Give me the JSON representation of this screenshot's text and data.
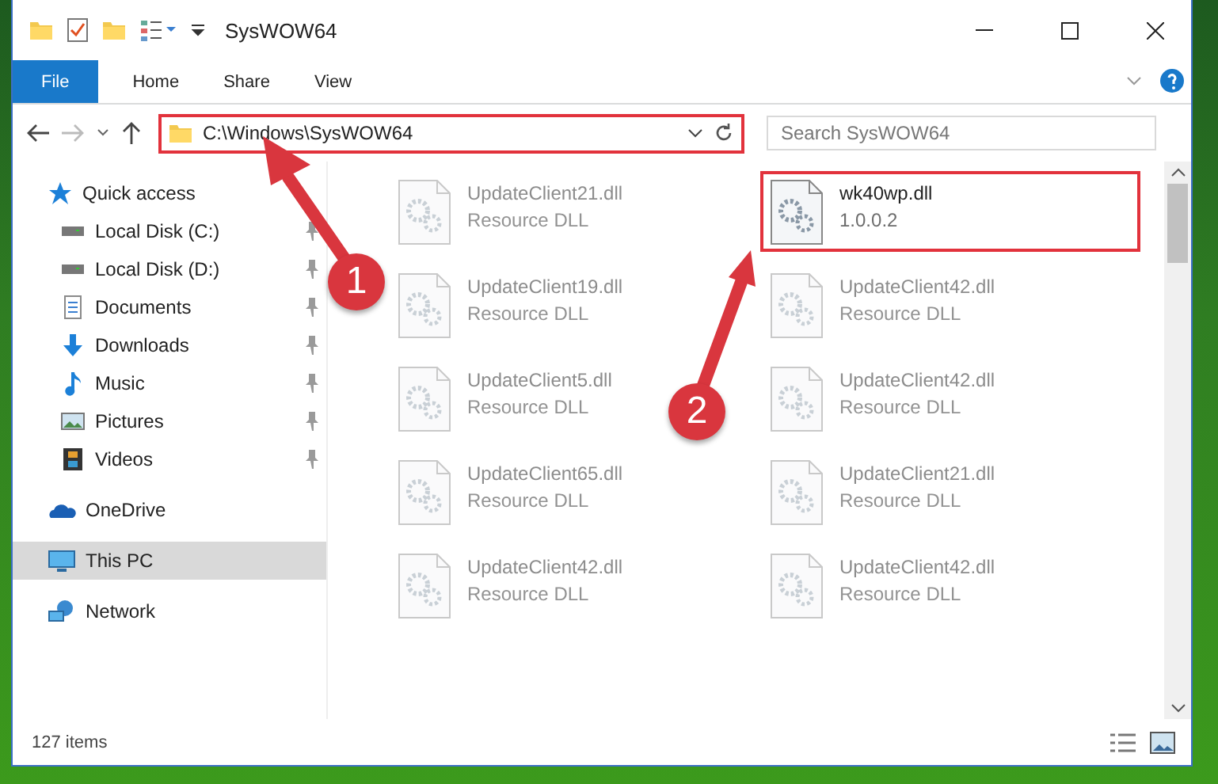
{
  "window": {
    "title": "SysWOW64"
  },
  "ribbon_tabs": [
    {
      "label": "File",
      "selected": true
    },
    {
      "label": "Home",
      "selected": false
    },
    {
      "label": "Share",
      "selected": false
    },
    {
      "label": "View",
      "selected": false
    }
  ],
  "address": {
    "path": "C:\\Windows\\SysWOW64"
  },
  "search": {
    "placeholder": "Search SysWOW64"
  },
  "sidebar": {
    "items": [
      {
        "label": "Quick access",
        "kind": "star",
        "selected": false,
        "pinned": false,
        "children": [
          {
            "label": "Local Disk (C:)",
            "kind": "disk",
            "selected": false,
            "pinned": true
          },
          {
            "label": "Local Disk (D:)",
            "kind": "disk",
            "selected": false,
            "pinned": true
          },
          {
            "label": "Documents",
            "kind": "documents",
            "selected": false,
            "pinned": true
          },
          {
            "label": "Downloads",
            "kind": "downloads",
            "selected": false,
            "pinned": true
          },
          {
            "label": "Music",
            "kind": "music",
            "selected": false,
            "pinned": true
          },
          {
            "label": "Pictures",
            "kind": "pictures",
            "selected": false,
            "pinned": true
          },
          {
            "label": "Videos",
            "kind": "videos",
            "selected": false,
            "pinned": true
          }
        ]
      },
      {
        "label": "OneDrive",
        "kind": "cloud",
        "selected": false,
        "pinned": false
      },
      {
        "label": "This PC",
        "kind": "pc",
        "selected": true,
        "pinned": false
      },
      {
        "label": "Network",
        "kind": "network",
        "selected": false,
        "pinned": false
      }
    ]
  },
  "files": [
    {
      "name": "UpdateClient21.dll",
      "detail": "Resource DLL",
      "highlighted": false
    },
    {
      "name": "wk40wp.dll",
      "detail": "1.0.0.2",
      "highlighted": true
    },
    {
      "name": "UpdateClient19.dll",
      "detail": "Resource DLL",
      "highlighted": false
    },
    {
      "name": "UpdateClient42.dll",
      "detail": "Resource DLL",
      "highlighted": false
    },
    {
      "name": "UpdateClient5.dll",
      "detail": "Resource DLL",
      "highlighted": false
    },
    {
      "name": "UpdateClient42.dll",
      "detail": "Resource DLL",
      "highlighted": false
    },
    {
      "name": "UpdateClient65.dll",
      "detail": "Resource DLL",
      "highlighted": false
    },
    {
      "name": "UpdateClient21.dll",
      "detail": "Resource DLL",
      "highlighted": false
    },
    {
      "name": "UpdateClient42.dll",
      "detail": "Resource DLL",
      "highlighted": false
    },
    {
      "name": "UpdateClient42.dll",
      "detail": "Resource DLL",
      "highlighted": false
    }
  ],
  "status_bar": {
    "count": "127 items"
  },
  "annotations": [
    {
      "number": "1"
    },
    {
      "number": "2"
    }
  ]
}
